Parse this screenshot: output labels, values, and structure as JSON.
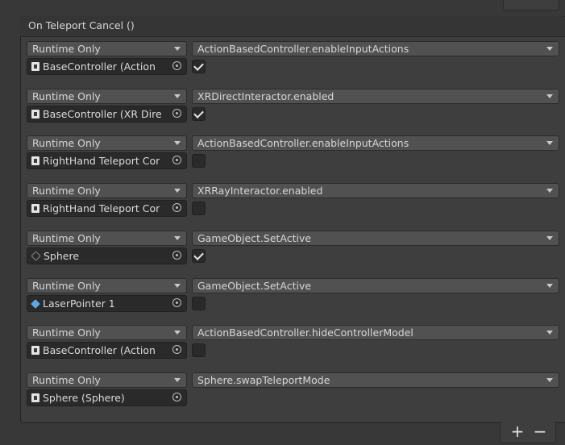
{
  "event": {
    "title": "On Teleport Cancel ()"
  },
  "entries": [
    {
      "state": "Runtime Only",
      "function": "ActionBasedController.enableInputActions",
      "object": "BaseController (Action",
      "icon": "script-icon",
      "checkbox": true
    },
    {
      "state": "Runtime Only",
      "function": "XRDirectInteractor.enabled",
      "object": "BaseController (XR Dire",
      "icon": "script-icon",
      "checkbox": true
    },
    {
      "state": "Runtime Only",
      "function": "ActionBasedController.enableInputActions",
      "object": "RightHand Teleport Cor",
      "icon": "script-icon",
      "checkbox": false
    },
    {
      "state": "Runtime Only",
      "function": "XRRayInteractor.enabled",
      "object": "RightHand Teleport Cor",
      "icon": "script-icon",
      "checkbox": false
    },
    {
      "state": "Runtime Only",
      "function": "GameObject.SetActive",
      "object": "Sphere",
      "icon": "gameobject-icon",
      "checkbox": true
    },
    {
      "state": "Runtime Only",
      "function": "GameObject.SetActive",
      "object": "LaserPointer 1",
      "icon": "prefab-icon",
      "checkbox": false
    },
    {
      "state": "Runtime Only",
      "function": "ActionBasedController.hideControllerModel",
      "object": "BaseController (Action",
      "icon": "script-icon",
      "checkbox": false
    },
    {
      "state": "Runtime Only",
      "function": "Sphere.swapTeleportMode",
      "object": "Sphere (Sphere)",
      "icon": "script-icon",
      "checkbox": null
    }
  ],
  "footer": {
    "add_label": "+",
    "remove_label": "−"
  },
  "colors": {
    "panel": "#3e3e3e",
    "dropdown": "#515151",
    "field": "#2a2a2a",
    "prefab_icon": "#5aa9e6"
  }
}
